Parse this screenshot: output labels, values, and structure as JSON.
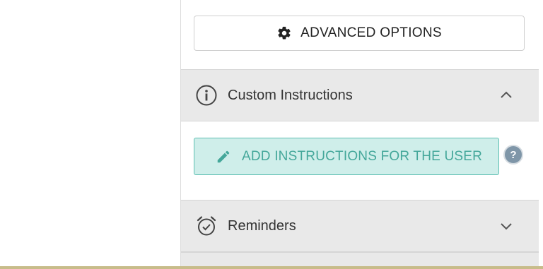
{
  "advanced_options": {
    "label": "ADVANCED OPTIONS",
    "icon": "gear-icon"
  },
  "custom_instructions": {
    "title": "Custom Instructions",
    "icon": "info-circle-icon",
    "expanded": true,
    "add_button_label": "ADD INSTRUCTIONS FOR THE USER",
    "help_label": "?"
  },
  "reminders": {
    "title": "Reminders",
    "icon": "alarm-clock-icon",
    "expanded": false
  },
  "colors": {
    "accent": "#44a79a",
    "accent_bg": "#cfeeea",
    "header_bg": "#e9e9e9",
    "help_bg": "#7f96a8"
  }
}
